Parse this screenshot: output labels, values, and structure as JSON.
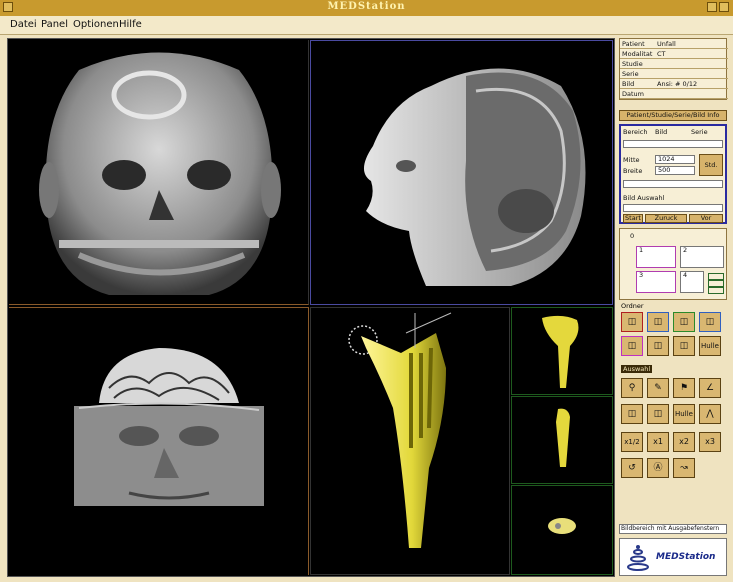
{
  "window": {
    "title": "MEDStation"
  },
  "menu": [
    "Datei",
    "Panel",
    "Optionen",
    "Hilfe"
  ],
  "info": [
    {
      "key": "Patient",
      "value": "Unfall"
    },
    {
      "key": "Modalitat",
      "value": "CT"
    },
    {
      "key": "Studie",
      "value": ""
    },
    {
      "key": "Serie",
      "value": ""
    },
    {
      "key": "Bild",
      "value": "Ansi: # 0/12"
    },
    {
      "key": "Datum",
      "value": ""
    }
  ],
  "info_button": "Patient/Studie/Serie/Bild Info",
  "bereich": {
    "label": "Bereich",
    "opt1": "Bild",
    "opt2": "Serie"
  },
  "window_level": {
    "mitte_label": "Mitte",
    "mitte_value": "1024",
    "breite_label": "Breite",
    "breite_value": "500",
    "set_button": "Std."
  },
  "bild_auswahl": {
    "label": "Bild Auswahl",
    "start": "Start",
    "zurueck": "Zuruck",
    "vor": "Vor"
  },
  "layout": {
    "label": "0",
    "cells": [
      "1",
      "2",
      "3",
      "4"
    ]
  },
  "ordner_label": "Ordner",
  "auswahl_label": "Auswahl",
  "tools": {
    "zoom1": "x1/2",
    "zoom2": "x1",
    "zoom3": "x2",
    "zoom4": "x3",
    "huelle1": "Hulle",
    "huelle2": "Hulle"
  },
  "status": "Bildbereich mit Ausgabefenstern",
  "logo": "MEDStation"
}
